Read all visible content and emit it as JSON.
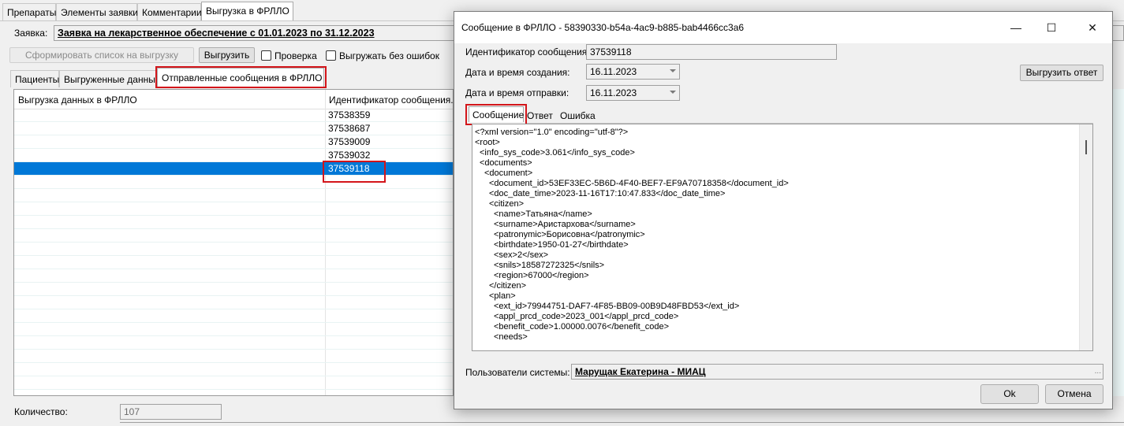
{
  "main": {
    "tabs_top": [
      "Препараты",
      "Элементы заявки",
      "Комментарии",
      "Выгрузка в ФРЛЛО"
    ],
    "request_label": "Заявка:",
    "request_value": "Заявка на лекарственное обеспечение с 01.01.2023 по 31.12.2023",
    "form_list_button": "Сформировать список на выгрузку",
    "upload_button": "Выгрузить",
    "check_label": "Проверка",
    "no_errors_label": "Выгружать без ошибок",
    "tabs_second": [
      "Пациенты",
      "Выгруженные данные",
      "Отправленные сообщения в ФРЛЛО"
    ],
    "grid": {
      "columns": [
        "Выгрузка данных в ФРЛЛО",
        "Идентификатор сообщения..."
      ],
      "rows": [
        "37538359",
        "37538687",
        "37539009",
        "37539032",
        "37539118"
      ],
      "selected_row": "37539118"
    },
    "count_label": "Количество:",
    "count_value": "107"
  },
  "dialog": {
    "title": "Сообщение в ФРЛЛО - 58390330-b54a-4ac9-b885-bab4466cc3a6",
    "minimize": "—",
    "maximize": "☐",
    "close": "✕",
    "id_label": "Идентификатор сообщения:",
    "id_value": "37539118",
    "created_label": "Дата и время создания:",
    "created_value": "16.11.2023",
    "sent_label": "Дата и время отправки:",
    "sent_value": "16.11.2023",
    "export_answer_button": "Выгрузить ответ",
    "tabs": [
      "Сообщение",
      "Ответ",
      "Ошибка"
    ],
    "xml_lines": [
      "<?xml version=\"1.0\" encoding=\"utf-8\"?>",
      "<root>",
      "<info_sys_code>3.061</info_sys_code>",
      "<documents>",
      "<document>",
      "<document_id>53EF33EC-5B6D-4F40-BEF7-EF9A70718358</document_id>",
      "<doc_date_time>2023-11-16T17:10:47.833</doc_date_time>",
      "<citizen>",
      "<name>Татьяна</name>",
      "<surname>Аристархова</surname>",
      "<patronymic>Борисовна</patronymic>",
      "<birthdate>1950-01-27</birthdate>",
      "<sex>2</sex>",
      "<snils>18587272325</snils>",
      "<region>67000</region>",
      "</citizen>",
      "<plan>",
      "<ext_id>79944751-DAF7-4F85-BB09-00B9D48FBD53</ext_id>",
      "<appl_prcd_code>2023_001</appl_prcd_code>",
      "<benefit_code>1.00000.0076</benefit_code>",
      "<needs>"
    ],
    "users_label": "Пользователи системы:",
    "users_value": "Марущак Екатерина - МИАЦ",
    "ellipsis": "...",
    "ok_button": "Ok",
    "cancel_button": "Отмена"
  }
}
